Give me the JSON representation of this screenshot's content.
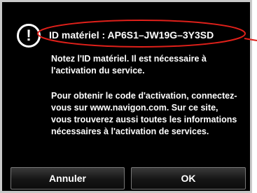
{
  "dialog": {
    "icon": "info-exclamation-icon",
    "id_line": "ID matériel : AP6S1–JW19G–3Y3SD",
    "paragraph1": "Notez l'ID matériel. Il est nécessaire à l'activation du service.",
    "paragraph2": "Pour obtenir le code d'activation, connectez-vous sur www.navigon.com. Sur ce site, vous trouverez aussi toutes les informations nécessaires à l'activation de services.",
    "cancel_label": "Annuler",
    "ok_label": "OK"
  },
  "annotation": {
    "color": "#e0201a"
  }
}
